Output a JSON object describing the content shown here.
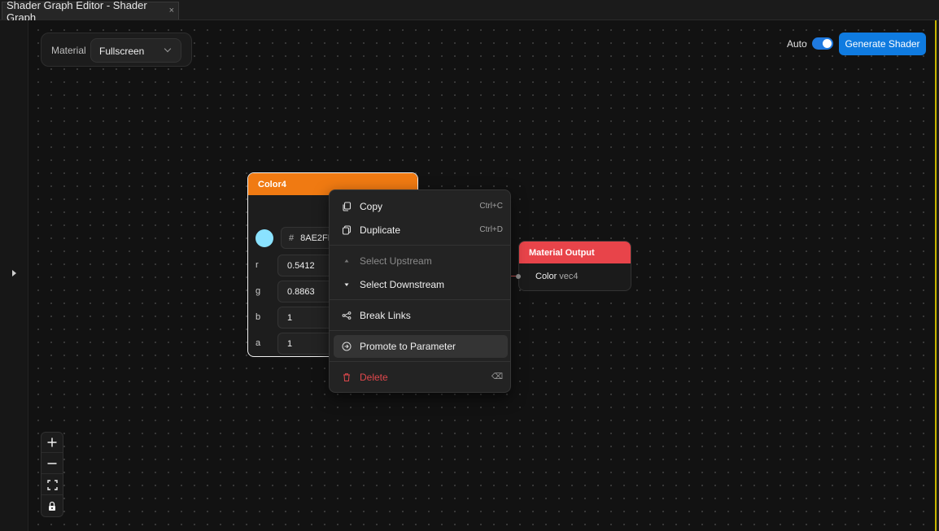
{
  "tab": {
    "title": "Shader Graph Editor - Shader Graph",
    "close": "×"
  },
  "material": {
    "label": "Material",
    "value": "Fullscreen"
  },
  "toolbar": {
    "auto_label": "Auto",
    "auto_enabled": true,
    "generate_label": "Generate Shader"
  },
  "colors": {
    "accent": "#0f7be0",
    "color4_header": "#f07a12",
    "output_header": "#e8444a",
    "swatch": "#8AE2FF",
    "danger": "#e0484c"
  },
  "node_color4": {
    "title": "Color4",
    "hex_prefix": "#",
    "hex": "8AE2FF",
    "channels": [
      {
        "label": "r",
        "value": "0.5412"
      },
      {
        "label": "g",
        "value": "0.8863"
      },
      {
        "label": "b",
        "value": "1"
      },
      {
        "label": "a",
        "value": "1"
      }
    ]
  },
  "node_output": {
    "title": "Material Output",
    "port_label": "Color",
    "port_type": "vec4"
  },
  "context_menu": {
    "items": [
      {
        "label": "Copy",
        "shortcut": "Ctrl+C",
        "icon": "copy-icon"
      },
      {
        "label": "Duplicate",
        "shortcut": "Ctrl+D",
        "icon": "duplicate-icon"
      },
      {
        "label": "Select Upstream",
        "icon": "triangle-up-icon",
        "disabled": true
      },
      {
        "label": "Select Downstream",
        "icon": "triangle-down-icon"
      },
      {
        "label": "Break Links",
        "icon": "break-links-icon"
      },
      {
        "label": "Promote to Parameter",
        "icon": "promote-icon",
        "hovered": true
      },
      {
        "label": "Delete",
        "shortcut": "⌫",
        "icon": "trash-icon",
        "danger": true
      }
    ]
  },
  "zoom": {
    "icons": [
      "zoom-in-icon",
      "zoom-out-icon",
      "fit-view-icon",
      "lock-icon"
    ]
  }
}
